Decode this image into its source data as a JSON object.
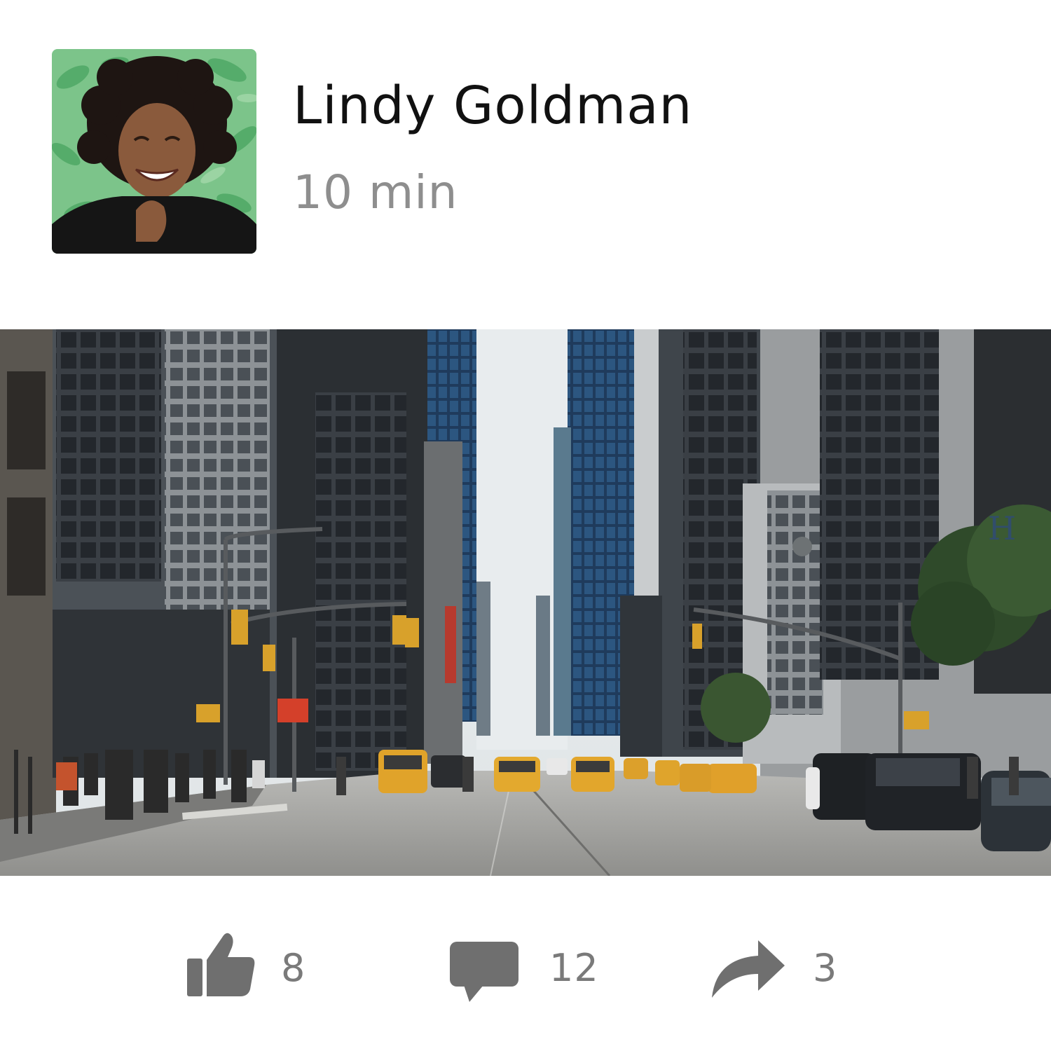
{
  "post": {
    "author_name": "Lindy Goldman",
    "time": "10 min"
  },
  "actions": {
    "like": {
      "icon": "thumbs-up-icon",
      "count": "8"
    },
    "comment": {
      "icon": "comment-icon",
      "count": "12"
    },
    "share": {
      "icon": "share-arrow-icon",
      "count": "3"
    }
  },
  "colors": {
    "name_text": "#111111",
    "muted_text": "#8e8e8e",
    "icon": "#6f6f6f",
    "background": "#ffffff"
  }
}
